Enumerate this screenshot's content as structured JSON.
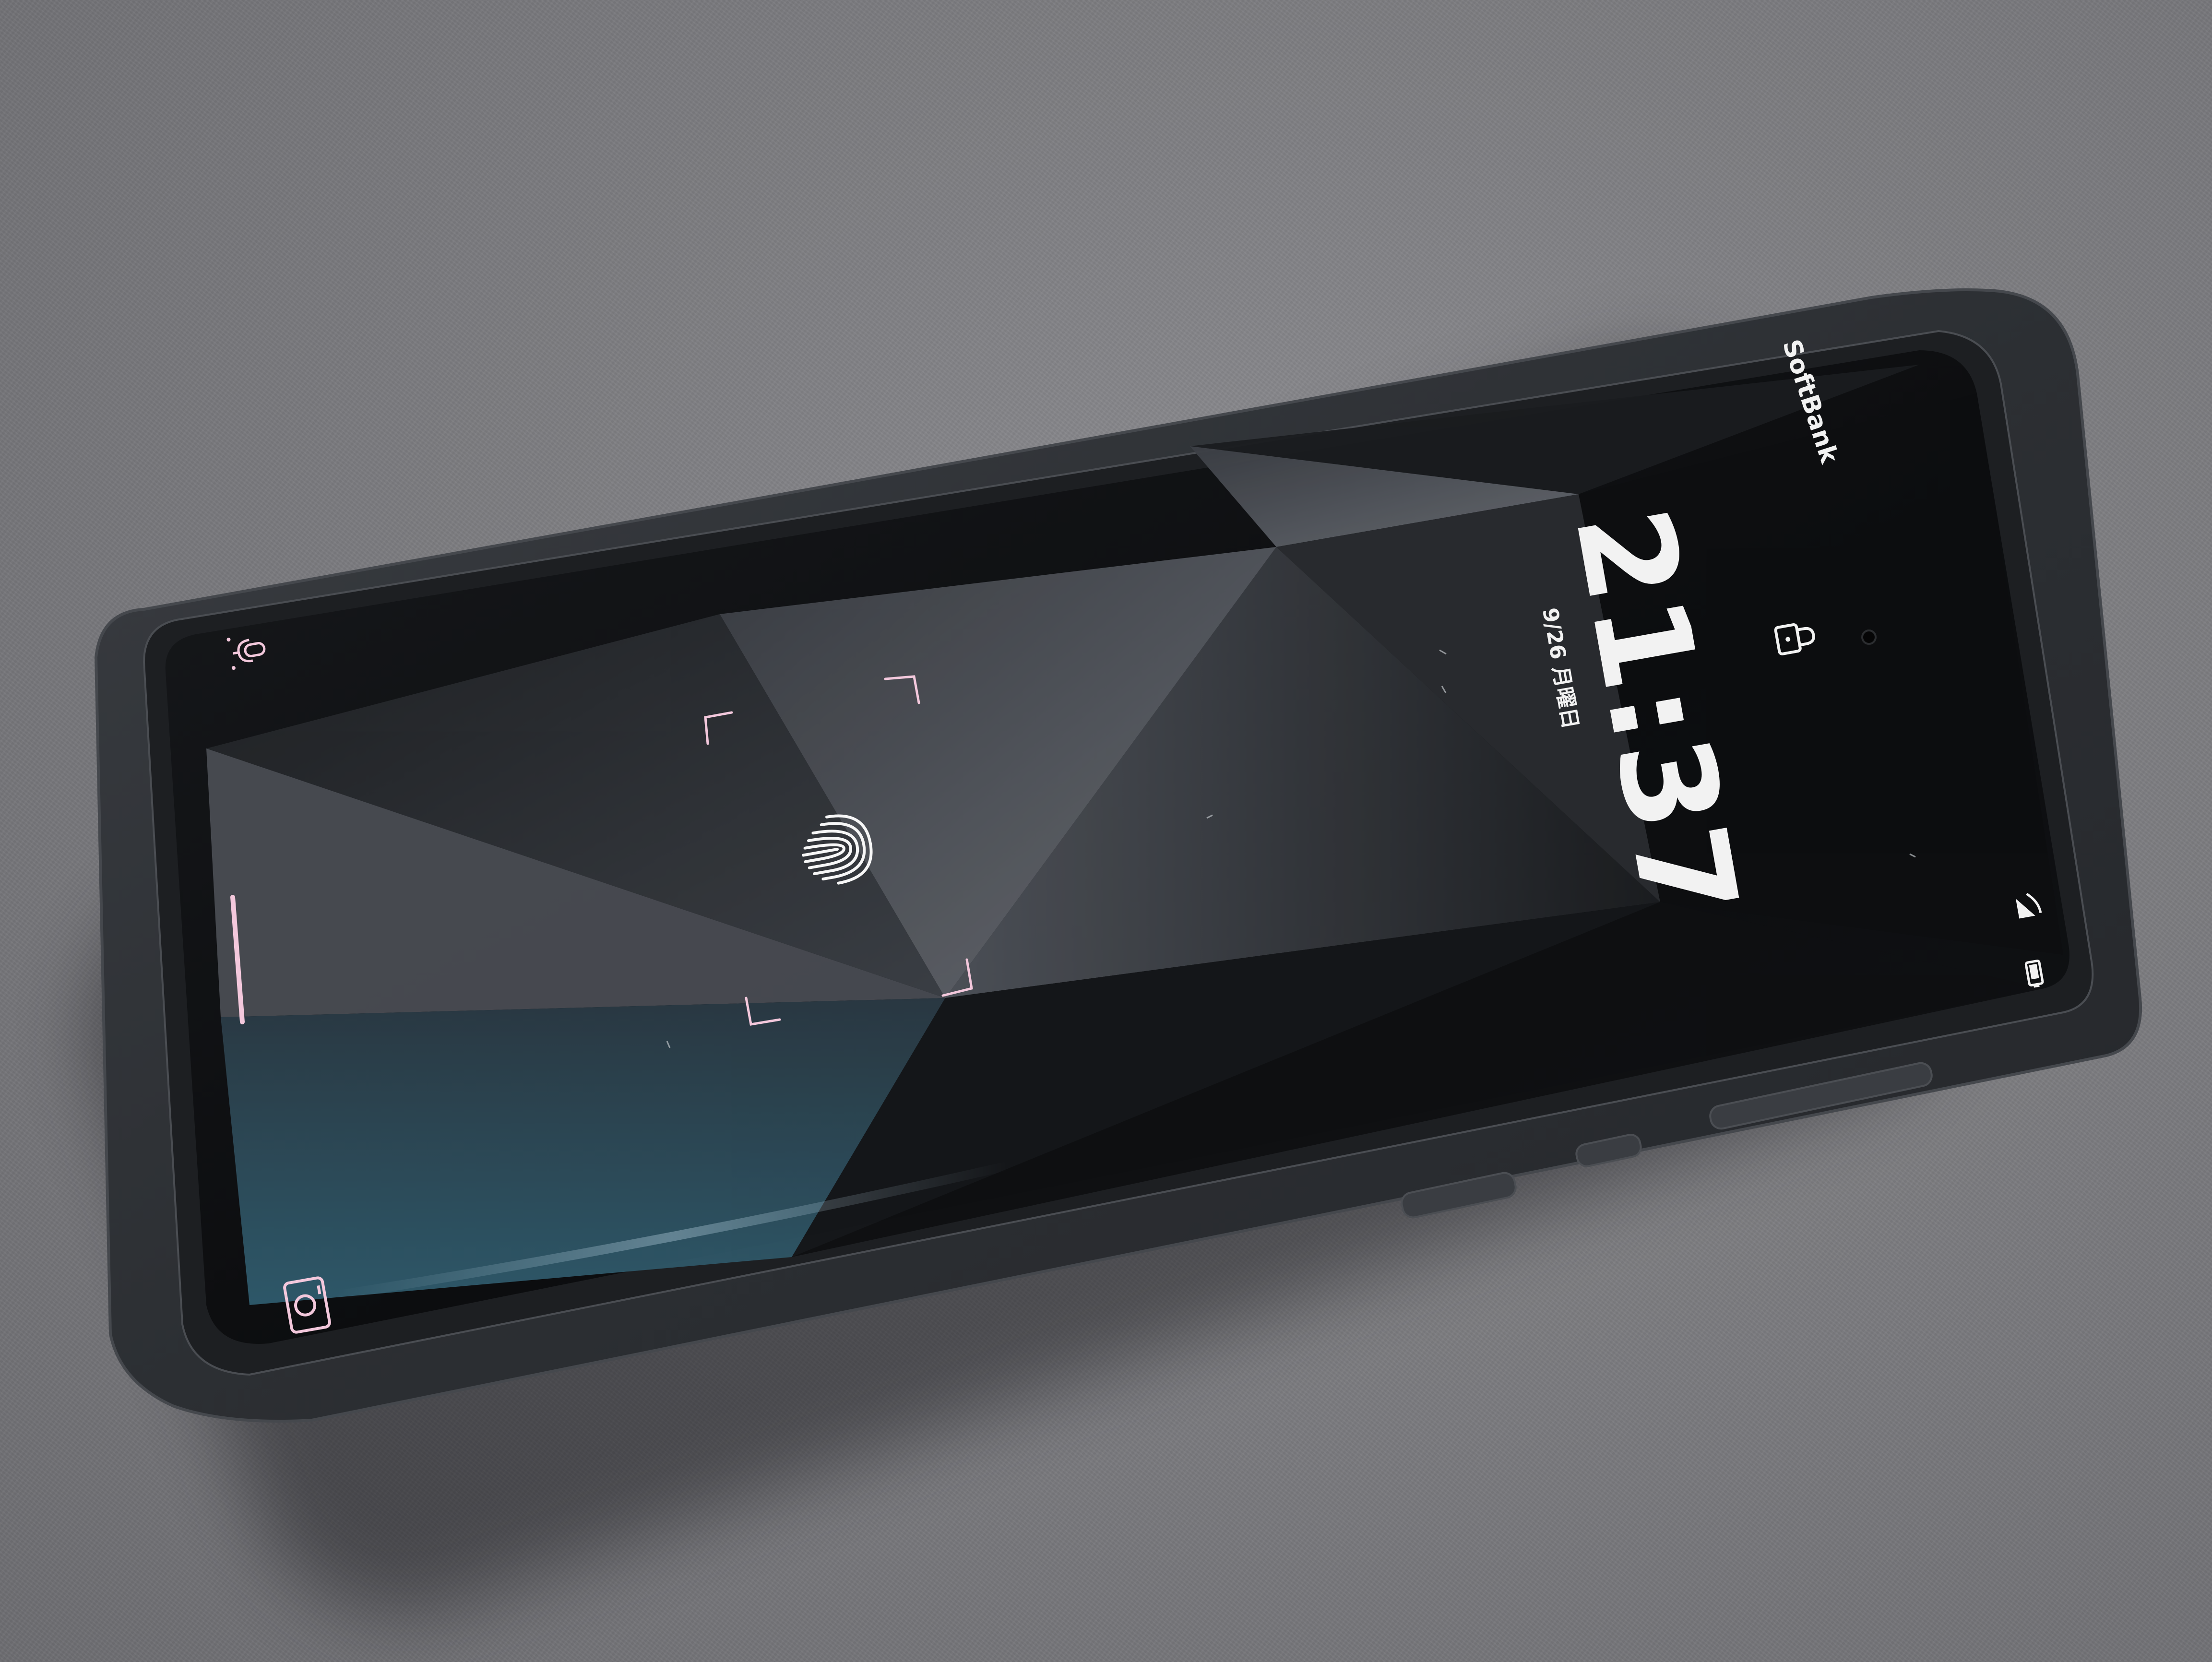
{
  "lockscreen": {
    "carrier": "SoftBank",
    "time": "21:37",
    "date": "9/26 月曜日"
  },
  "colors": {
    "case": "#2f3236",
    "case_edge": "#3c3f44",
    "screen_dark": "#0b0c0e",
    "wallpaper_light": "#6b6f76",
    "wallpaper_teal": "#2e5566",
    "ui_accent_pink": "#f3c8dc",
    "text_white": "#f5f5f5"
  },
  "icons": {
    "voice_assistant": "microphone-icon",
    "lock": "lock-icon",
    "fingerprint": "fingerprint-icon",
    "camera": "camera-icon",
    "signal": "signal-icon",
    "battery": "battery-icon"
  }
}
